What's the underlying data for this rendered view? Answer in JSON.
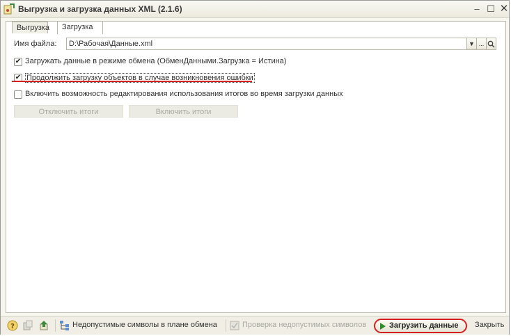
{
  "window": {
    "title": "Выгрузка и загрузка данных XML (2.1.6)",
    "minimize": "–",
    "maximize": "☐",
    "close": "✕"
  },
  "tabs": [
    {
      "label": "Выгрузка",
      "active": false
    },
    {
      "label": "Загрузка",
      "active": true
    }
  ],
  "file": {
    "label": "Имя файла:",
    "value": "D:\\Рабочая\\Данные.xml",
    "dropdown": "▼",
    "browse": "...",
    "open": "🔍"
  },
  "options": [
    {
      "label": "Загружать данные в режиме обмена (ОбменДанными.Загрузка = Истина)",
      "checked": true
    },
    {
      "label": "Продолжить загрузку объектов в случае возникновения ошибки",
      "checked": true
    },
    {
      "label": "Включить возможность редактирования использования итогов во время загрузки данных",
      "checked": false
    }
  ],
  "totals_buttons": {
    "disable": "Отключить итоги",
    "enable": "Включить итоги"
  },
  "bottom": {
    "invalid_symbols": "Недопустимые символы в плане обмена",
    "check_symbols": "Проверка недопустимых символов",
    "load_data": "Загрузить данные",
    "close": "Закрыть"
  },
  "colors": {
    "highlight": "#d62020",
    "play": "#2e8b2e"
  },
  "icons": [
    "help-icon",
    "save-icon",
    "import-icon",
    "tree-icon",
    "check-icon",
    "play-icon"
  ]
}
